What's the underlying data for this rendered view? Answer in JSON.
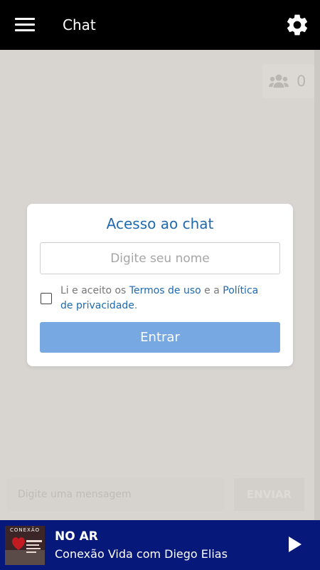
{
  "header": {
    "title": "Chat",
    "menu_icon": "hamburger-menu-icon",
    "settings_icon": "gear-icon"
  },
  "users": {
    "icon": "users-group-icon",
    "count": "0"
  },
  "login_dialog": {
    "title": "Acesso ao chat",
    "name_placeholder": "Digite seu nome",
    "terms_prefix": "Li e aceito os ",
    "terms_link": "Termos de uso",
    "terms_middle": " e a ",
    "privacy_link": "Política de privacidade",
    "terms_suffix": ".",
    "accepted": false,
    "enter_label": "Entrar"
  },
  "composer": {
    "placeholder": "Digite uma mensagem",
    "send_label": "ENVIAR"
  },
  "player": {
    "cover_text": "CONEXÃO",
    "status": "NO AR",
    "program": "Conexão Vida com Diego Elias",
    "play_icon": "play-icon"
  },
  "colors": {
    "topbar": "#000000",
    "background": "#d8d5d1",
    "accent": "#1f69b0",
    "button": "#78a8e2",
    "player": "#06197a"
  }
}
